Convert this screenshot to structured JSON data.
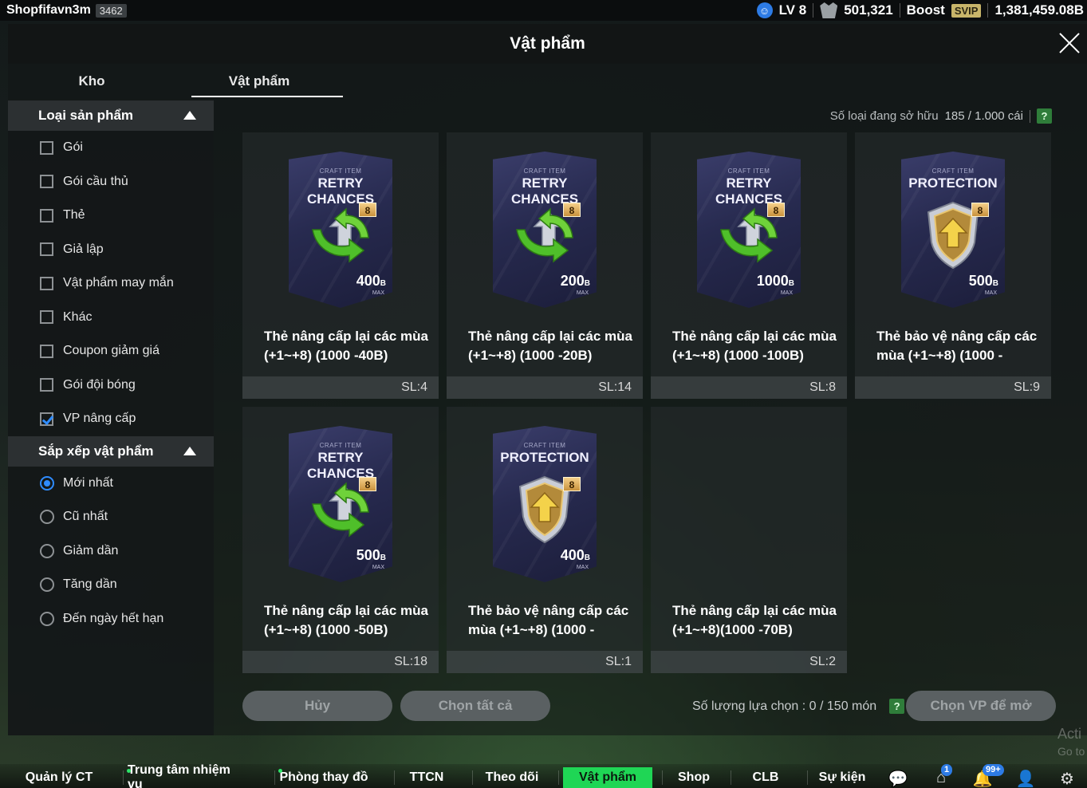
{
  "topbar": {
    "username": "Shopfifavn3m",
    "user_id": "3462",
    "level": "LV 8",
    "coins": "501,321",
    "boost_label": "Boost",
    "svip_label": "SVIP",
    "balance": "1,381,459.08B"
  },
  "window": {
    "title": "Vật phẩm"
  },
  "tabs": [
    {
      "label": "Kho",
      "active": false
    },
    {
      "label": "Vật phẩm",
      "active": true
    }
  ],
  "sidebar": {
    "category_title": "Loại sản phẩm",
    "categories": [
      {
        "label": "Gói",
        "checked": false
      },
      {
        "label": "Gói cầu thủ",
        "checked": false
      },
      {
        "label": "Thẻ",
        "checked": false
      },
      {
        "label": "Giả lập",
        "checked": false
      },
      {
        "label": "Vật phẩm may mắn",
        "checked": false
      },
      {
        "label": "Khác",
        "checked": false
      },
      {
        "label": "Coupon giảm giá",
        "checked": false
      },
      {
        "label": "Gói đội bóng",
        "checked": false
      },
      {
        "label": "VP nâng cấp",
        "checked": true
      }
    ],
    "sort_title": "Sắp xếp vật phẩm",
    "sorts": [
      {
        "label": "Mới nhất",
        "selected": true
      },
      {
        "label": "Cũ nhất",
        "selected": false
      },
      {
        "label": "Giảm dần",
        "selected": false
      },
      {
        "label": "Tăng dần",
        "selected": false
      },
      {
        "label": "Đến ngày hết hạn",
        "selected": false
      }
    ]
  },
  "capacity": {
    "label": "Số loại đang sở hữu",
    "value": "185 / 1.000 cái",
    "help": "?"
  },
  "items": [
    {
      "card_small": "CRAFT ITEM",
      "card_big": "RETRY CHANCES",
      "level": "8",
      "amount": "400",
      "unit": "B",
      "max": "MAX",
      "kind": "retry",
      "name": "Thẻ nâng cấp lại các mùa\n(+1~+8) (1000 -40B)",
      "qty": "SL:4"
    },
    {
      "card_small": "CRAFT ITEM",
      "card_big": "RETRY CHANCES",
      "level": "8",
      "amount": "200",
      "unit": "B",
      "max": "MAX",
      "kind": "retry",
      "name": "Thẻ nâng cấp lại các mùa\n(+1~+8) (1000 -20B)",
      "qty": "SL:14"
    },
    {
      "card_small": "CRAFT ITEM",
      "card_big": "RETRY CHANCES",
      "level": "8",
      "amount": "1000",
      "unit": "B",
      "max": "MAX",
      "kind": "retry",
      "name": "Thẻ nâng cấp lại các mùa\n(+1~+8) (1000 -100B)",
      "qty": "SL:8"
    },
    {
      "card_small": "CRAFT ITEM",
      "card_big": "PROTECTION",
      "level": "8",
      "amount": "500",
      "unit": "B",
      "max": "MAX",
      "kind": "shield",
      "name": "Thẻ bảo vệ nâng cấp các\nmùa (+1~+8) (1000 -",
      "qty": "SL:9"
    },
    {
      "card_small": "CRAFT ITEM",
      "card_big": "RETRY CHANCES",
      "level": "8",
      "amount": "500",
      "unit": "B",
      "max": "MAX",
      "kind": "retry",
      "name": "Thẻ nâng cấp lại các mùa\n(+1~+8) (1000 -50B)",
      "qty": "SL:18"
    },
    {
      "card_small": "CRAFT ITEM",
      "card_big": "PROTECTION",
      "level": "8",
      "amount": "400",
      "unit": "B",
      "max": "MAX",
      "kind": "shield",
      "name": "Thẻ bảo vệ nâng cấp các\nmùa (+1~+8) (1000 -",
      "qty": "SL:1"
    },
    {
      "card_small": "",
      "card_big": "",
      "level": "",
      "amount": "",
      "unit": "",
      "max": "",
      "kind": "none",
      "name": "Thẻ nâng cấp lại các mùa\n(+1~+8)(1000 -70B)",
      "qty": "SL:2"
    }
  ],
  "footer": {
    "cancel_label": "Hủy",
    "select_all_label": "Chọn tất cả",
    "selection_count": "Số lượng lựa chọn : 0 / 150 món",
    "help": "?",
    "open_label": "Chọn VP để mở"
  },
  "bottom_nav": [
    {
      "label": "Quản lý CT",
      "active": false,
      "dot": false
    },
    {
      "label": "Trung tâm nhiệm vụ",
      "active": false,
      "dot": true
    },
    {
      "label": "Phòng thay đồ",
      "active": false,
      "dot": true
    },
    {
      "label": "TTCN",
      "active": false,
      "dot": false
    },
    {
      "label": "Theo dõi",
      "active": false,
      "dot": false
    },
    {
      "label": "Vật phẩm",
      "active": true,
      "dot": false
    },
    {
      "label": "Shop",
      "active": false,
      "dot": false
    },
    {
      "label": "CLB",
      "active": false,
      "dot": false
    },
    {
      "label": "Sự kiện",
      "active": false,
      "dot": false
    }
  ],
  "bottom_icons": [
    {
      "name": "chat-icon",
      "badge": ""
    },
    {
      "name": "home-icon",
      "badge": "1"
    },
    {
      "name": "bell-icon",
      "badge": "99+"
    },
    {
      "name": "profile-icon",
      "badge": ""
    },
    {
      "name": "settings-icon",
      "badge": ""
    }
  ],
  "watermark": {
    "line1": "Acti",
    "line2": "Go to"
  },
  "colors": {
    "accent": "#1fd655",
    "blue": "#2f8cff",
    "card": "#272a4f"
  }
}
